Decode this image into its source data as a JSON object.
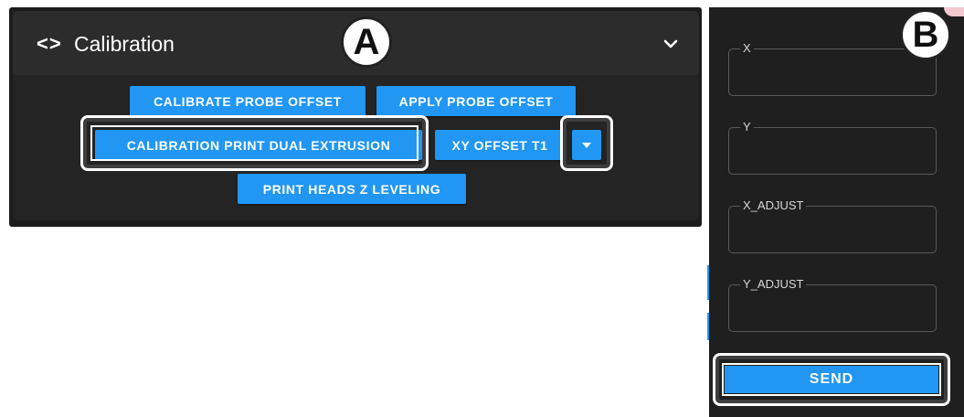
{
  "panel_a": {
    "badge": "A",
    "header": {
      "icon": "code-brackets-icon",
      "icon_text": "<>",
      "title": "Calibration",
      "collapse_icon": "chevron-down-icon"
    },
    "buttons": {
      "calibrate_probe_offset": "CALIBRATE PROBE OFFSET",
      "apply_probe_offset": "APPLY PROBE OFFSET",
      "calibration_print_dual_extrusion": "CALIBRATION PRINT DUAL EXTRUSION",
      "xy_offset_t1": "XY OFFSET T1",
      "dropdown_icon": "caret-down-icon",
      "print_heads_z_leveling": "PRINT HEADS Z LEVELING"
    }
  },
  "panel_b": {
    "badge": "B",
    "fields": [
      {
        "label": "X",
        "value": ""
      },
      {
        "label": "Y",
        "value": ""
      },
      {
        "label": "X_ADJUST",
        "value": ""
      },
      {
        "label": "Y_ADJUST",
        "value": ""
      }
    ],
    "send_label": "SEND"
  },
  "colors": {
    "accent": "#2196f3",
    "panel_bg": "#242424",
    "header_bg": "#2c2c2c"
  }
}
